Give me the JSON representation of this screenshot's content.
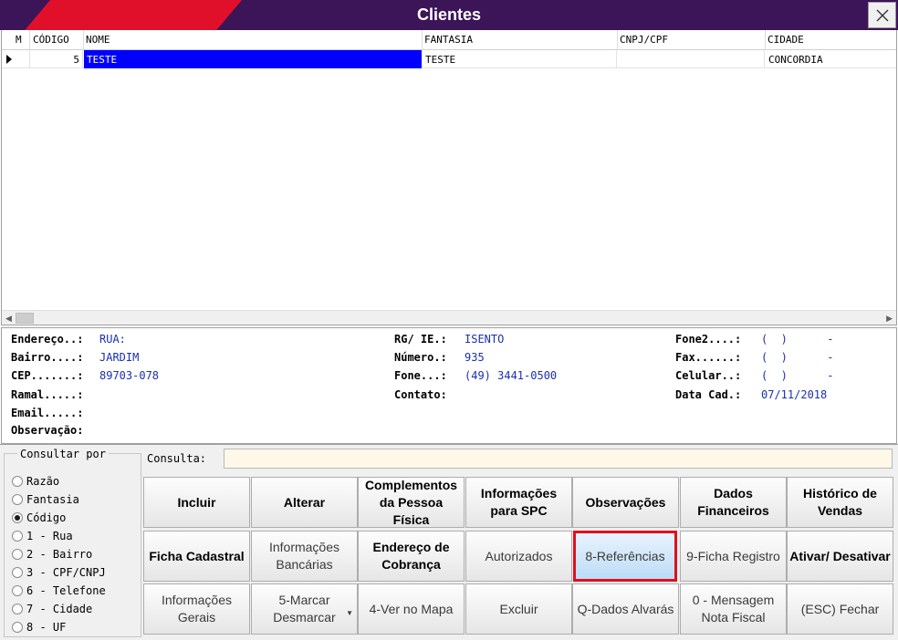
{
  "window": {
    "title": "Clientes"
  },
  "grid": {
    "columns": [
      "M",
      "CÓDIGO",
      "NOME",
      "FANTASIA",
      "CNPJ/CPF",
      "CIDADE"
    ],
    "rows": [
      {
        "m": "",
        "codigo": "5",
        "nome": "TESTE",
        "fantasia": "TESTE",
        "cnpj": "",
        "cidade": "CONCORDIA"
      }
    ]
  },
  "details": {
    "endereco_label": "Endereço..:",
    "endereco": "RUA:",
    "bairro_label": "Bairro....:",
    "bairro": "JARDIM",
    "cep_label": "CEP.......:",
    "cep": "89703-078",
    "ramal_label": "Ramal.....:",
    "ramal": "",
    "email_label": "Email.....:",
    "email": "",
    "observacao_label": "Observação:",
    "observacao": "",
    "rg_label": "RG/ IE.:",
    "rg": "ISENTO",
    "numero_label": "Número.:",
    "numero": "935",
    "fone_label": "Fone...:",
    "fone": "(49) 3441-0500",
    "contato_label": "Contato:",
    "contato": "",
    "fone2_label": "Fone2....:",
    "fone2": "(  )      -",
    "fax_label": "Fax......:",
    "fax": "(  )      -",
    "celular_label": "Celular..:",
    "celular": "(  )      -",
    "datacad_label": "Data Cad.:",
    "datacad": "07/11/2018"
  },
  "consultar": {
    "legend": "Consultar por",
    "options": [
      "Razão",
      "Fantasia",
      "Código",
      "1 - Rua",
      "2 - Bairro",
      "3 - CPF/CNPJ",
      "6 - Telefone",
      "7 - Cidade",
      "8 - UF"
    ],
    "selected": "Código"
  },
  "consulta": {
    "label": "Consulta:",
    "value": ""
  },
  "buttons": {
    "incluir": "Incluir",
    "alterar": "Alterar",
    "complementos": "Complementos da Pessoa Física",
    "info_spc": "Informações para SPC",
    "observacoes": "Observações",
    "dados_financeiros": "Dados Financeiros",
    "historico": "Histórico de Vendas",
    "ficha_cadastral": "Ficha Cadastral",
    "info_bancarias": "Informações Bancárias",
    "endereco_cobranca": "Endereço de Cobrança",
    "autorizados": "Autorizados",
    "referencias": "8-Referências",
    "ficha_registro": "9-Ficha Registro",
    "ativar": "Ativar/ Desativar",
    "info_gerais": "Informações Gerais",
    "marcar": "5-Marcar Desmarcar",
    "ver_mapa": "4-Ver no Mapa",
    "excluir": "Excluir",
    "dados_alvaras": "Q-Dados Alvarás",
    "mensagem_nf": "0 - Mensagem Nota Fiscal",
    "fechar": "(ESC) Fechar"
  },
  "colors": {
    "titlebar": "#3c1458",
    "accent_red": "#e0102a",
    "selection_blue": "#0000ff",
    "value_blue": "#1a2fb0"
  }
}
